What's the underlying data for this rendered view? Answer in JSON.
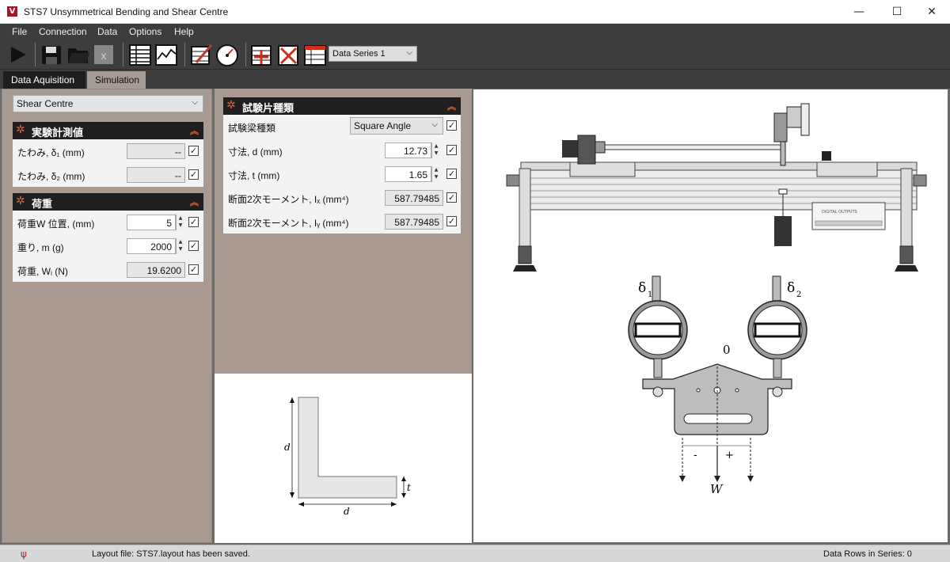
{
  "window": {
    "title": "STS7 Unsymmetrical Bending and Shear Centre",
    "icon_letter": "V",
    "minimize": "—",
    "maximize": "☐",
    "close": "✕"
  },
  "menu": [
    "File",
    "Connection",
    "Data",
    "Options",
    "Help"
  ],
  "toolbar": {
    "series_select": "Data Series 1"
  },
  "tabs": [
    "Data Aquisition",
    "Simulation"
  ],
  "left": {
    "mode_select": "Shear Centre",
    "measure_panel": {
      "title": "実験計測値",
      "rows": [
        {
          "label": "たわみ, δ₁ (mm)",
          "value": "--"
        },
        {
          "label": "たわみ, δ₂ (mm)",
          "value": "--"
        }
      ]
    },
    "load_panel": {
      "title": "荷重",
      "rows": [
        {
          "label": "荷重W  位置, (mm)",
          "value": "5"
        },
        {
          "label": "重り, m (g)",
          "value": "2000"
        },
        {
          "label": "荷重, Wᵢ (N)",
          "value": "19.6200"
        }
      ]
    }
  },
  "specimen": {
    "title": "試験片種類",
    "rows": [
      {
        "label": "試験梁種類",
        "value": "Square Angle"
      },
      {
        "label": "寸法, d (mm)",
        "value": "12.73"
      },
      {
        "label": "寸法, t (mm)",
        "value": "1.65"
      },
      {
        "label": "断面2次モーメント, Iₓ (mm⁴)",
        "value": "587.79485"
      },
      {
        "label": "断面2次モーメント, Iᵧ (mm⁴)",
        "value": "587.79485"
      }
    ]
  },
  "section_diagram": {
    "d_left": "d",
    "d_bottom": "d",
    "t_label": "t"
  },
  "rig_diagram": {
    "delta1": "δ",
    "delta1_sub": "1",
    "delta2": "δ",
    "delta2_sub": "2",
    "zero": "0",
    "minus": "-",
    "plus": "+",
    "load": "W",
    "panel_text": "DIGITAL OUTPUTS"
  },
  "status": {
    "message": "Layout file: STS7.layout has been saved.",
    "rows": "Data Rows in Series: 0"
  },
  "colors": {
    "accent": "#e06040",
    "panel_header": "#1f1f1f",
    "background": "#a89a91"
  }
}
